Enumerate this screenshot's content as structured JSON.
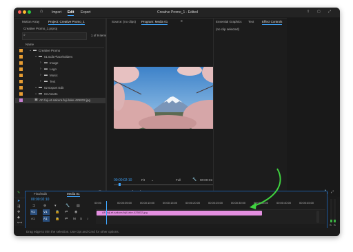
{
  "window": {
    "title": "Creative Promo_1 - Edited",
    "menus": [
      "Import",
      "Edit",
      "Export"
    ],
    "active_menu": "Edit"
  },
  "project_panel": {
    "tabs": [
      "Motion Array",
      "Project: Creative Promo_1"
    ],
    "project_file": "Creative Promo_1.prproj",
    "item_count": "1 of 9 items...",
    "column_header": "Name",
    "items": [
      {
        "label": "Creative Promo",
        "color": "#e79d33",
        "indent": 0,
        "type": "folder"
      },
      {
        "label": "01 Edit Placeholders",
        "color": "#e79d33",
        "indent": 1,
        "type": "folder"
      },
      {
        "label": "Image",
        "color": "#e79d33",
        "indent": 2,
        "type": "folder"
      },
      {
        "label": "Logo",
        "color": "#e79d33",
        "indent": 2,
        "type": "folder"
      },
      {
        "label": "Music",
        "color": "#e79d33",
        "indent": 2,
        "type": "folder"
      },
      {
        "label": "Text",
        "color": "#e79d33",
        "indent": 2,
        "type": "folder"
      },
      {
        "label": "02 Export Edit",
        "color": "#e79d33",
        "indent": 1,
        "type": "folder"
      },
      {
        "label": "03 Assets",
        "color": "#e79d33",
        "indent": 1,
        "type": "folder"
      },
      {
        "label": "AF-fuji-et-sakura-fuji-lake-425832.jpg",
        "color": "#c77fd1",
        "indent": 1,
        "type": "image"
      }
    ]
  },
  "source_tab": "Source: (no clips)",
  "program_monitor": {
    "tab": "Program: Media 01",
    "timecode": "00:00:02:10",
    "fit": "Fit",
    "quality": "Full",
    "duration": "00:00:31:00"
  },
  "right_panel": {
    "tabs": [
      "Essential Graphics",
      "Text",
      "Effect Controls"
    ],
    "no_clip": "(no clip selected)",
    "timecode": "00:00:00:00"
  },
  "timeline": {
    "tabs": [
      "Final Edit",
      "Media 01"
    ],
    "timecode": "00:00:02:10",
    "ruler": [
      "00:00",
      "00:00:05:00",
      "00:00:10:00",
      "00:00:15:00",
      "00:00:20:00",
      "00:00:25:00",
      "00:00:30:00",
      "00:00:35:00",
      "00:00:40:00",
      "00:00:45:00"
    ],
    "tracks": [
      "V1",
      "A1"
    ],
    "clip_label": "AF-fuji-et-sakura-fuji-lake-425832.jpg",
    "clip_color": "#e38fe0",
    "meter_labels": [
      "S",
      "S"
    ]
  },
  "status_bar": {
    "text": "Drag edge to trim the selection. Use Opt and Cmd for other options."
  },
  "annotation": {
    "color": "#3fd23f"
  }
}
